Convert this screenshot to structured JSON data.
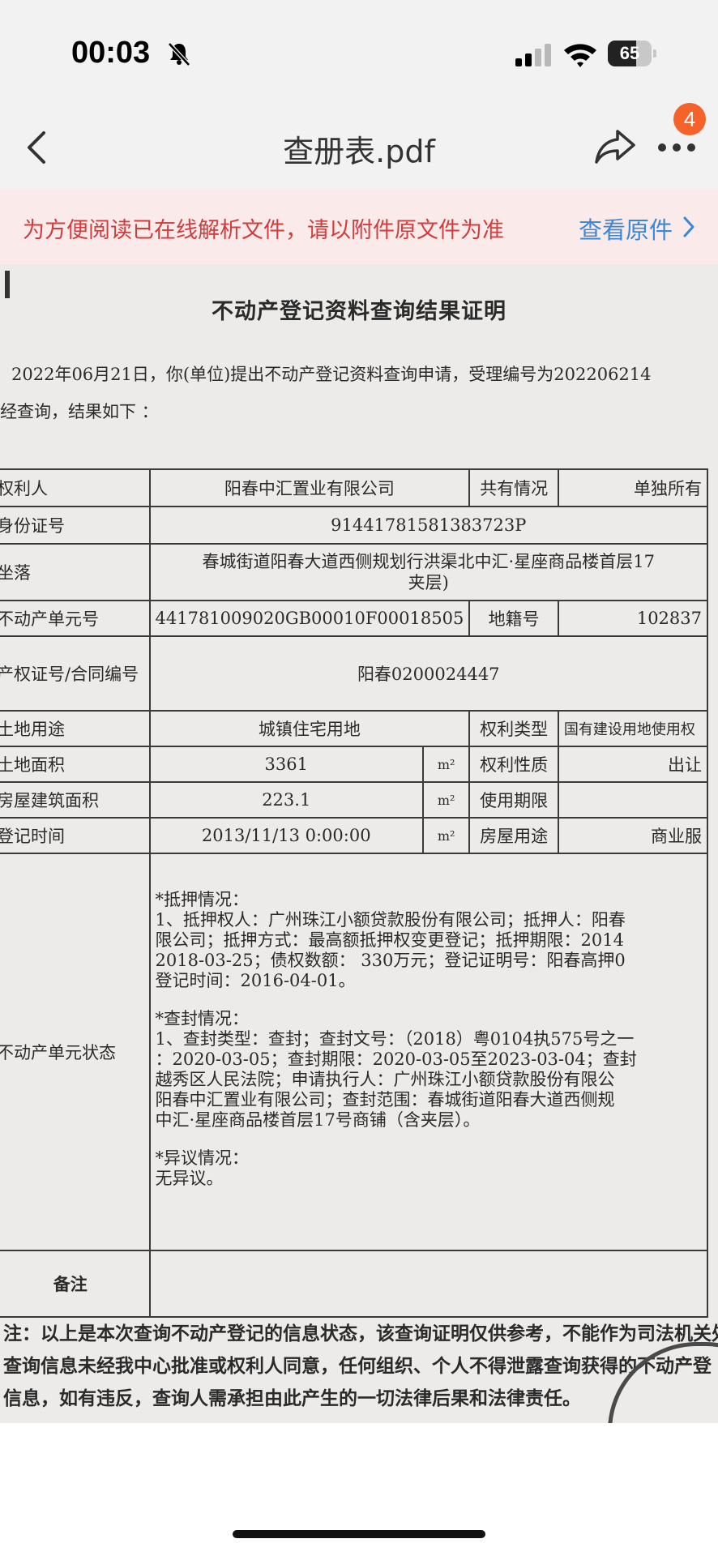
{
  "status_bar": {
    "time": "00:03",
    "battery": "65",
    "battery_level": 0.65
  },
  "nav": {
    "title": "查册表.pdf",
    "badge": "4"
  },
  "notice": {
    "text": "为方便阅读已在线解析文件，请以附件原文件为准",
    "link": "查看原件"
  },
  "document": {
    "title": "不动产登记资料查询结果证明",
    "intro_line1": "2022年06月21日，你(单位)提出不动产登记资料查询申请，受理编号为202206214",
    "intro_line2": "经查询，结果如下 ：",
    "rows": {
      "owner_label": "权利人",
      "owner_value": "阳春中汇置业有限公司",
      "co_owner_label": "共有情况",
      "co_owner_value": "单独所有",
      "id_label": "身份证号",
      "id_value": "91441781581383723P",
      "location_label": "坐落",
      "location_value_1": "春城街道阳春大道西侧规划行洪渠北中汇·星座商品楼首层17",
      "location_value_2": "夹层)",
      "unit_label": "不动产单元号",
      "unit_value": "441781009020GB00010F00018505",
      "cadastral_label": "地籍号",
      "cadastral_value": "102837",
      "cert_label": "产权证号/合同编号",
      "cert_value": "阳春0200024447",
      "land_use_label": "土地用途",
      "land_use_value": "城镇住宅用地",
      "right_type_label": "权利类型",
      "right_type_value": "国有建设用地使用权",
      "land_area_label": "土地面积",
      "land_area_value": "3361",
      "land_area_unit": "m²",
      "right_nature_label": "权利性质",
      "right_nature_value": "出让",
      "building_area_label": "房屋建筑面积",
      "building_area_value": "223.1",
      "building_area_unit": "m²",
      "term_label": "使用期限",
      "term_value": "",
      "reg_time_label": "登记时间",
      "reg_time_value": "2013/11/13 0:00:00",
      "reg_time_unit": "m²",
      "house_use_label": "房屋用途",
      "house_use_value": "商业服",
      "unit_status_label": "不动产单元状态",
      "mortgage": [
        "*抵押情况：",
        "1、抵押权人：广州珠江小额贷款股份有限公司；抵押人：阳春",
        "限公司；抵押方式：最高额抵押权变更登记；抵押期限：2014",
        "2018-03-25；债权数额： 330万元；登记证明号：阳春高押0",
        "登记时间：2016-04-01。"
      ],
      "seizure": [
        "*查封情况：",
        "1、查封类型：查封；查封文号：（2018）粤0104执575号之一",
        "：2020-03-05；查封期限：2020-03-05至2023-03-04；查封",
        "越秀区人民法院；申请执行人：广州珠江小额贷款股份有限公",
        "阳春中汇置业有限公司；查封范围：春城街道阳春大道西侧规",
        "中汇·星座商品楼首层17号商铺（含夹层）。"
      ],
      "objection": [
        "*异议情况：",
        "无异议。"
      ],
      "remark_label": "备注"
    },
    "footer_1": "注：以上是本次查询不动产登记的信息状态，该查询证明仅供参考，不能作为司法机关处置",
    "footer_2": "查询信息未经我中心批准或权利人同意，任何组织、个人不得泄露查询获得的不动产登",
    "footer_3": "信息，如有违反，查询人需承担由此产生的一切法律后果和法律责任。"
  }
}
